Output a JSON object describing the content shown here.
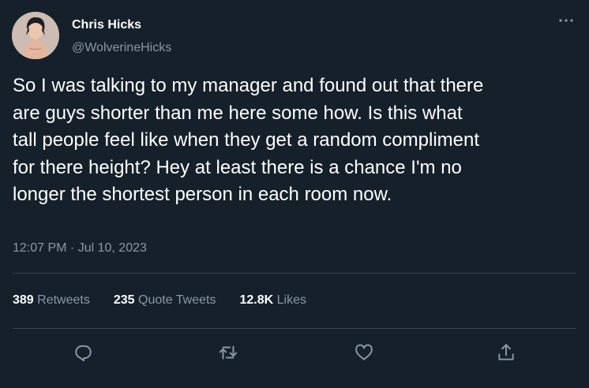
{
  "tweet": {
    "author_name": "Chris Hicks",
    "author_handle": "@WolverineHicks",
    "text_lines": [
      "So I was talking to my manager and found out that there",
      "are guys shorter than me here some how. Is this what",
      "tall people feel like when they get a random compliment",
      "for there height? Hey at least there is a chance I'm no",
      "longer the shortest person in each room now."
    ],
    "timestamp": "12:07 PM · Jul 10, 2023",
    "more_icon": "ellipsis-icon"
  },
  "stats": {
    "retweets_count": "389",
    "retweets_label": "Retweets",
    "quotes_count": "235",
    "quotes_label": "Quote Tweets",
    "likes_count": "12.8K",
    "likes_label": "Likes"
  },
  "actions": {
    "reply_icon": "reply-icon",
    "retweet_icon": "retweet-icon",
    "like_icon": "heart-icon",
    "share_icon": "share-icon"
  },
  "colors": {
    "background": "#15202b",
    "primary_text": "#ffffff",
    "secondary_text": "#8b98a5",
    "divider": "#38444d"
  }
}
